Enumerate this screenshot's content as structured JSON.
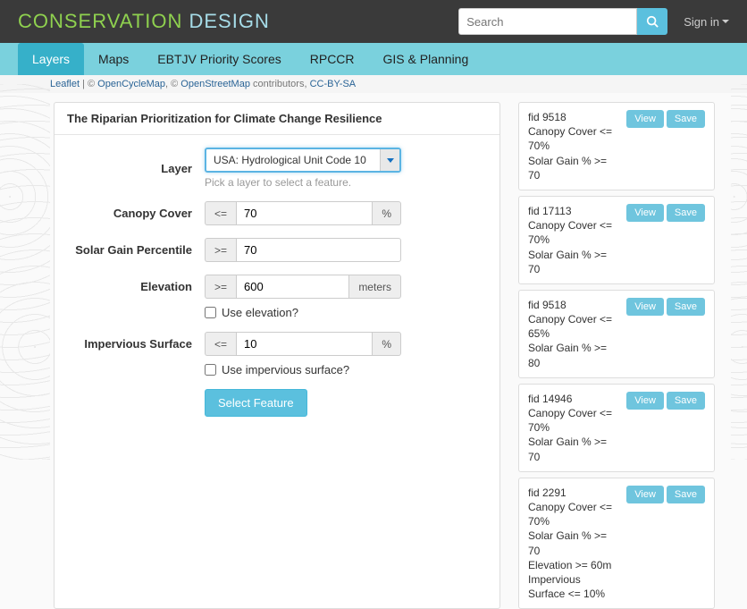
{
  "brand": {
    "a": "CONSERVATION",
    "b": "DESIGN"
  },
  "search": {
    "placeholder": "Search"
  },
  "signin": "Sign in",
  "subnav": {
    "items": [
      "Layers",
      "Maps",
      "EBTJV Priority Scores",
      "RPCCR",
      "GIS & Planning"
    ],
    "active": 0
  },
  "attrib": {
    "leaflet": "Leaflet",
    "sep1": " | © ",
    "ocm": "OpenCycleMap",
    "sep2": ", © ",
    "osm": "OpenStreetMap",
    "contrib": " contributors, ",
    "cc": "CC-BY-SA"
  },
  "panel": {
    "title": "The Riparian Prioritization for Climate Change Resilience",
    "layer_label": "Layer",
    "layer_value": "USA: Hydrological Unit Code 10",
    "layer_helper": "Pick a layer to select a feature.",
    "canopy_label": "Canopy Cover",
    "canopy_op": "<=",
    "canopy_val": "70",
    "canopy_unit": "%",
    "solar_label": "Solar Gain Percentile",
    "solar_op": ">=",
    "solar_val": "70",
    "elev_label": "Elevation",
    "elev_op": ">=",
    "elev_val": "600",
    "elev_unit": "meters",
    "elev_chk": "Use elevation?",
    "imperv_label": "Impervious Surface",
    "imperv_op": "<=",
    "imperv_val": "10",
    "imperv_unit": "%",
    "imperv_chk": "Use impervious surface?",
    "submit": "Select Feature"
  },
  "cards": [
    {
      "lines": [
        "fid 9518",
        "Canopy Cover <= 70%",
        "Solar Gain % >= 70"
      ],
      "view": "View",
      "save": "Save"
    },
    {
      "lines": [
        "fid 17113",
        "Canopy Cover <= 70%",
        "Solar Gain % >= 70"
      ],
      "view": "View",
      "save": "Save"
    },
    {
      "lines": [
        "fid 9518",
        "Canopy Cover <= 65%",
        "Solar Gain % >= 80"
      ],
      "view": "View",
      "save": "Save"
    },
    {
      "lines": [
        "fid 14946",
        "Canopy Cover <= 70%",
        "Solar Gain % >= 70"
      ],
      "view": "View",
      "save": "Save"
    },
    {
      "lines": [
        "fid 2291",
        "Canopy Cover <= 70%",
        "Solar Gain % >= 70",
        "Elevation >= 60m",
        "Impervious Surface <= 10%"
      ],
      "view": "View",
      "save": "Save"
    }
  ]
}
